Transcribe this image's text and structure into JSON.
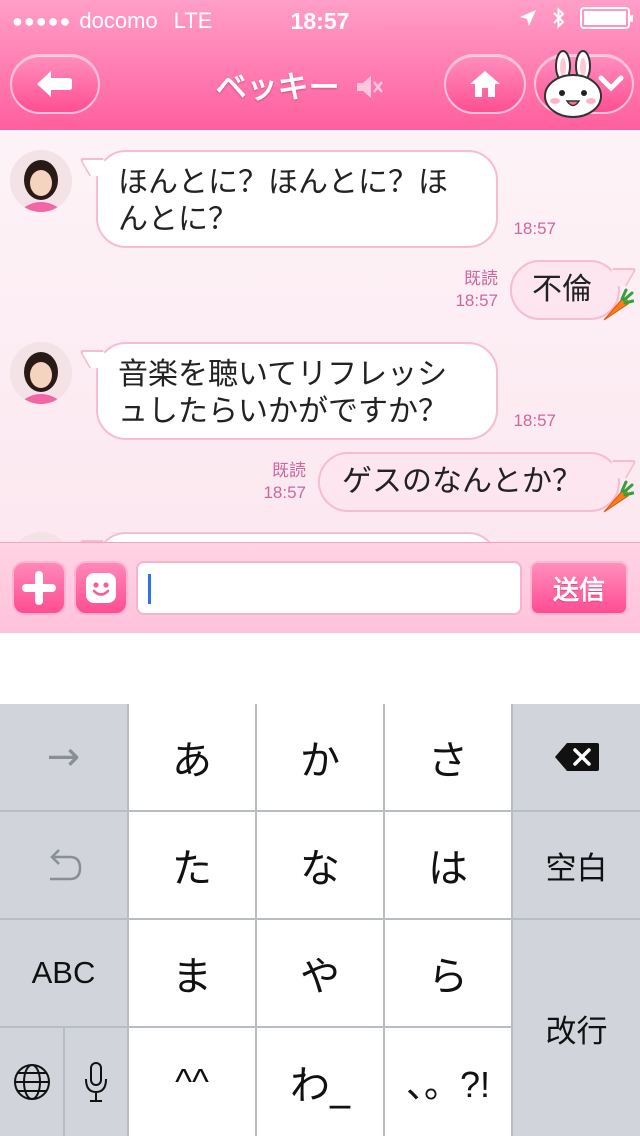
{
  "status_bar": {
    "signal_dots": "●●●●●",
    "carrier": "docomo",
    "network": "LTE",
    "time": "18:57",
    "location_icon": "location-arrow-icon",
    "bluetooth_icon": "bluetooth-icon",
    "battery_icon": "battery-icon"
  },
  "header": {
    "title": "ベッキー",
    "back_icon": "arrow-left-icon",
    "home_icon": "home-icon",
    "menu_icon": "chevron-down-icon",
    "mute_icon": "speaker-mute-icon",
    "accent_color": "#ff5f9f"
  },
  "messages": [
    {
      "direction": "in",
      "text_line1": "ほんとに？ほんとに？ほ",
      "text_line2": "んとに？",
      "time": "18:57"
    },
    {
      "direction": "out",
      "text": "不倫",
      "read": "既読",
      "time": "18:57"
    },
    {
      "direction": "in",
      "text_line1": "音楽を聴いてリフレッシ",
      "text_line2": "ュしたらいかがですか？",
      "time": "18:57"
    },
    {
      "direction": "out",
      "text": "ゲスのなんとか？",
      "read": "既読",
      "time": "18:57"
    }
  ],
  "input_bar": {
    "input_value": "",
    "send_label": "送信",
    "plus_icon": "plus-icon",
    "emoji_icon": "smiley-icon"
  },
  "keyboard": {
    "row1": [
      "→",
      "あ",
      "か",
      "さ",
      "⌫"
    ],
    "row2": [
      "↶",
      "た",
      "な",
      "は",
      "空白"
    ],
    "row3": [
      "ABC",
      "ま",
      "や",
      "ら",
      "改行"
    ],
    "row4": [
      "🌐",
      "🎤",
      "^^",
      "わ_",
      "、。?!"
    ]
  }
}
